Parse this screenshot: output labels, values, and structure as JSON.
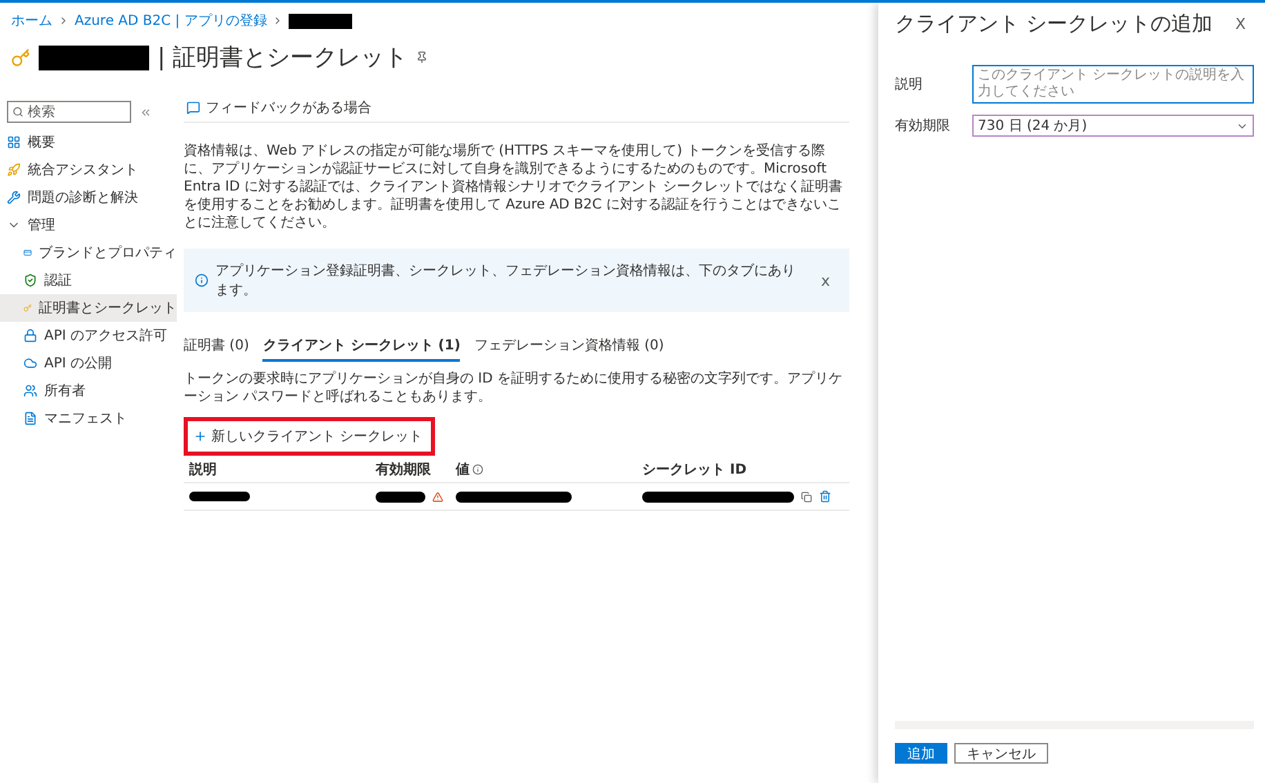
{
  "breadcrumb": [
    {
      "label": "ホーム"
    },
    {
      "label": "Azure AD B2C | アプリの登録"
    }
  ],
  "page_title": "| 証明書とシークレット",
  "sidebar": {
    "search": {
      "placeholder": "検索"
    },
    "items": [
      {
        "label": "概要",
        "selected": false
      },
      {
        "label": "統合アシスタント",
        "selected": false
      },
      {
        "label": "問題の診断と解決",
        "selected": false
      },
      {
        "label": "管理",
        "selected": false,
        "expanded": true,
        "children": [
          {
            "label": "ブランドとプロパティ",
            "selected": false
          },
          {
            "label": "認証",
            "selected": false
          },
          {
            "label": "証明書とシークレット",
            "selected": true
          },
          {
            "label": "API のアクセス許可",
            "selected": false
          },
          {
            "label": "API の公開",
            "selected": false
          },
          {
            "label": "所有者",
            "selected": false
          },
          {
            "label": "マニフェスト",
            "selected": false
          }
        ]
      }
    ]
  },
  "toolbar": {
    "feedback": "フィードバックがある場合"
  },
  "description": "資格情報は、Web アドレスの指定が可能な場所で (HTTPS スキーマを使用して) トークンを受信する際に、アプリケーションが認証サービスに対して自身を識別できるようにするためのものです。Microsoft Entra ID に対する認証では、クライアント資格情報シナリオでクライアント シークレットではなく証明書を使用することをお勧めします。証明書を使用して Azure AD B2C に対する認証を行うことはできないことに注意してください。",
  "info_banner": {
    "text": "アプリケーション登録証明書、シークレット、フェデレーション資格情報は、下のタブにあります。",
    "close": "x"
  },
  "tabs": [
    {
      "label": "証明書 (0)",
      "selected": false
    },
    {
      "label": "クライアント シークレット (1)",
      "selected": true
    },
    {
      "label": "フェデレーション資格情報 (0)",
      "selected": false
    }
  ],
  "tab_description": "トークンの要求時にアプリケーションが自身の ID を証明するために使用する秘密の文字列です。アプリケーション パスワードと呼ばれることもあります。",
  "new_secret_button": "新しいクライアント シークレット",
  "table": {
    "columns": [
      "説明",
      "有効期限",
      "値",
      "シークレット ID"
    ],
    "rows": [
      {
        "expires_warning": true
      }
    ]
  },
  "panel": {
    "title": "クライアント シークレットの追加",
    "close": "X",
    "fields": [
      {
        "label": "説明",
        "kind": "text",
        "placeholder": "このクライアント シークレットの説明を入力してください"
      },
      {
        "label": "有効期限",
        "kind": "select",
        "value": "730 日 (24 か月)"
      }
    ],
    "buttons": [
      {
        "label": "追加",
        "primary": true
      },
      {
        "label": "キャンセル",
        "primary": false
      }
    ]
  }
}
